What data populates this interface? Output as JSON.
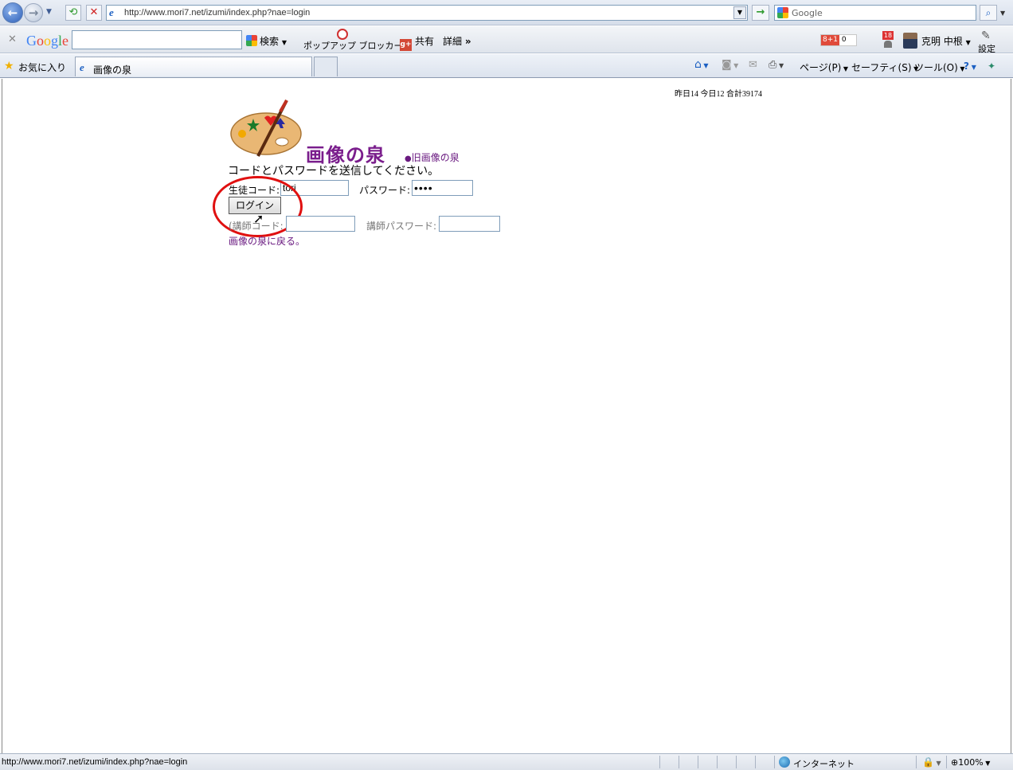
{
  "browser": {
    "address": "http://www.mori7.net/izumi/index.php?nae=login",
    "search_placeholder": "Google",
    "tab_title": "画像の泉",
    "favorites_label": "お気に入り",
    "commands": {
      "page": "ページ(P)",
      "safety": "セーフティ(S)",
      "tools": "ツール(O)"
    },
    "status_url": "http://www.mori7.net/izumi/index.php?nae=login",
    "zone": "インターネット",
    "zoom": "100%"
  },
  "google_toolbar": {
    "logo": "Google",
    "search_label": "検索",
    "popup_blocker": "ポップアップ ブロッカー",
    "share_label": "共有",
    "more_label": "詳細",
    "plus_one": "8+1",
    "plus_count": "0",
    "notification_count": "18",
    "user_name": "克明 中根",
    "settings_label": "設定"
  },
  "page": {
    "counter": "昨日14 今日12 合計39174",
    "site_title": "画像の泉",
    "old_link": "旧画像の泉",
    "instruction": "コードとパスワードを送信してください。",
    "student_code_label": "生徒コード:",
    "student_code_value": "tori",
    "student_password_label": "パスワード:",
    "student_password_value": "••••",
    "login_button": "ログイン",
    "teacher_code_label": "(講師コード:",
    "teacher_password_label": "講師パスワード:",
    "back_link": "画像の泉に戻る。"
  },
  "colors": {
    "title": "#7a1d8c",
    "link": "#6a1a80",
    "highlight_circle": "#e01010"
  }
}
